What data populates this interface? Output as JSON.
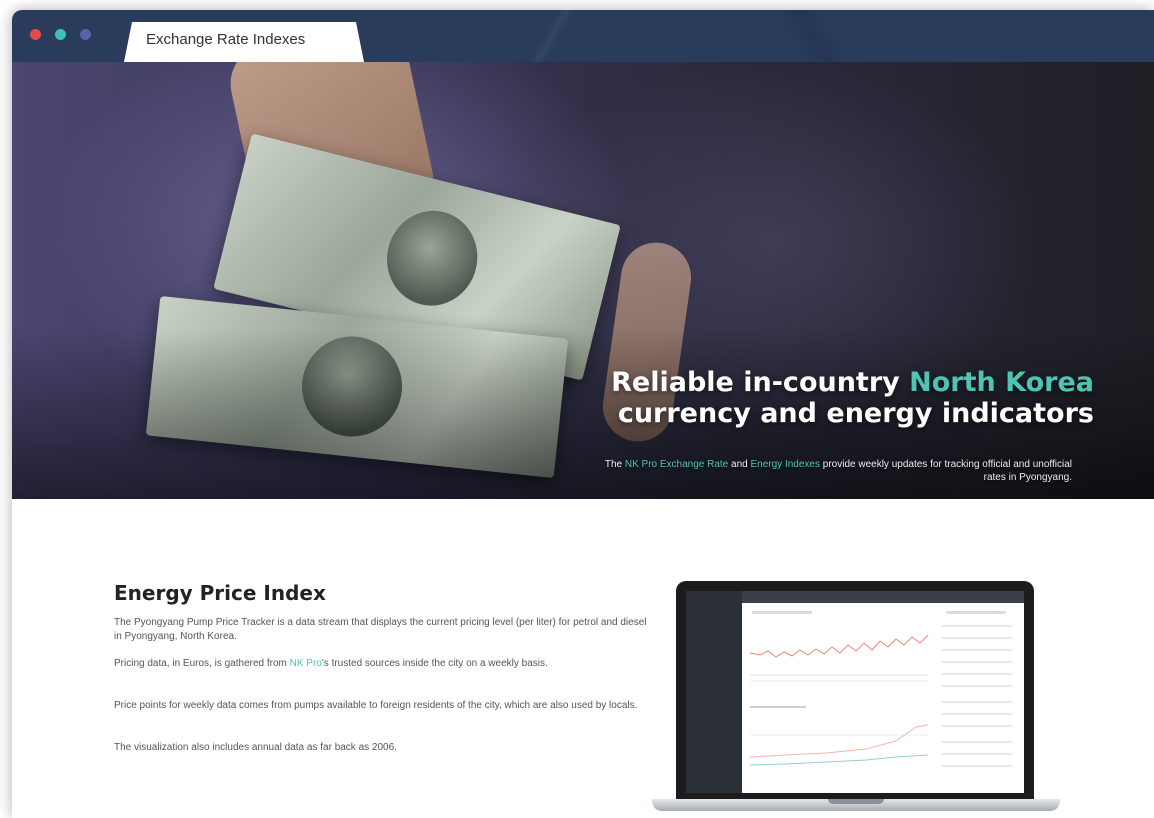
{
  "window": {
    "tab_title": "Exchange Rate Indexes",
    "controls": [
      "close-dot",
      "minimize-dot",
      "maximize-dot"
    ]
  },
  "colors": {
    "titlebar": "#2a3b5c",
    "accent_teal": "#4fc4b4",
    "dot_red": "#e24b4b",
    "dot_teal": "#3fc1b3",
    "dot_blue": "#5563a8"
  },
  "hero": {
    "title_line1_a": "Reliable in-country ",
    "title_line1_accent": "North Korea",
    "title_line2": "currency and energy indicators",
    "sub_a": "The ",
    "sub_accent1": "NK Pro Exchange Rate",
    "sub_b": " and ",
    "sub_accent2": "Energy Indexes",
    "sub_c": " provide weekly updates for tracking official and unofficial rates in Pyongyang."
  },
  "section": {
    "title": "Energy Price Index",
    "p1": "The Pyongyang Pump Price Tracker is a data stream that displays the current pricing level (per liter) for petrol and diesel in Pyongyang, North Korea.",
    "p2_a": "Pricing data, in Euros, is gathered from ",
    "p2_accent": "NK Pro",
    "p2_b": "'s trusted sources inside the city on a weekly basis.",
    "p3": "Price points for weekly data comes from pumps available to foreign residents of the city, which are also used by locals.",
    "p4": "The visualization also includes annual data as far back as 2006."
  }
}
